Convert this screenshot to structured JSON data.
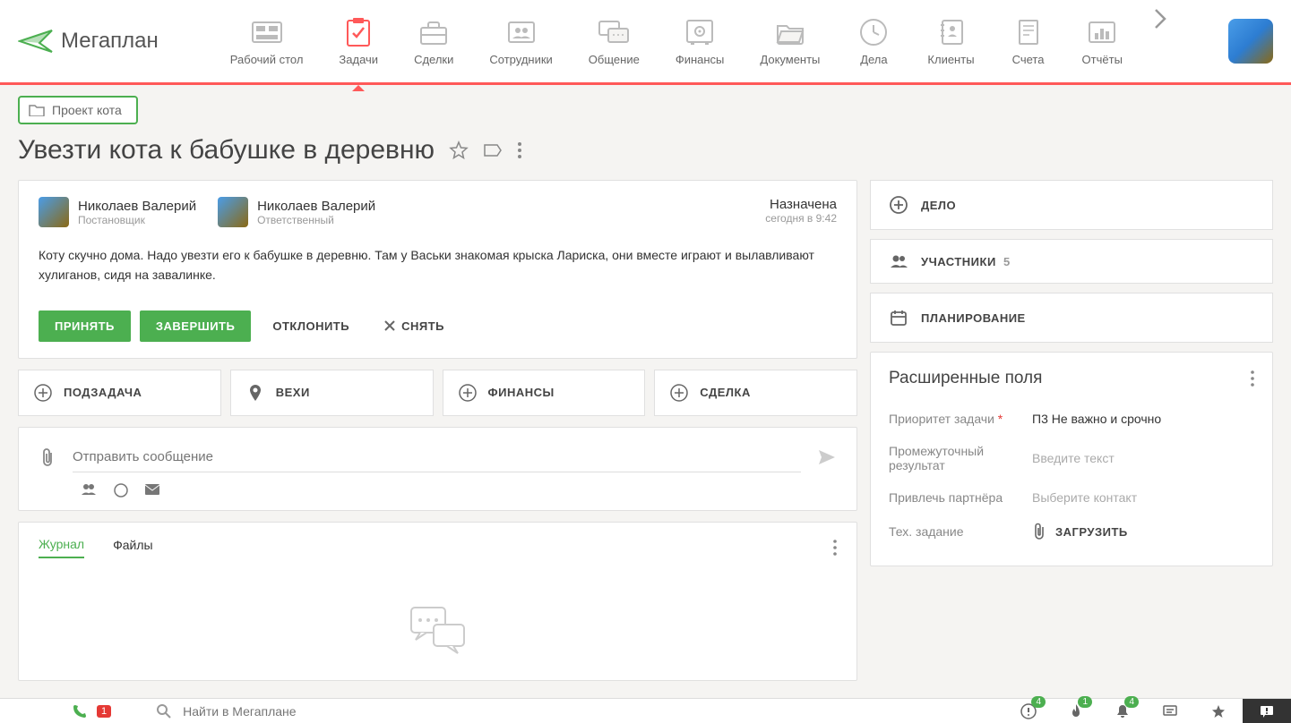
{
  "logo": {
    "text": "Мегаплан"
  },
  "nav": {
    "items": [
      {
        "label": "Рабочий стол"
      },
      {
        "label": "Задачи"
      },
      {
        "label": "Сделки"
      },
      {
        "label": "Сотрудники"
      },
      {
        "label": "Общение"
      },
      {
        "label": "Финансы"
      },
      {
        "label": "Документы"
      },
      {
        "label": "Дела"
      },
      {
        "label": "Клиенты"
      },
      {
        "label": "Счета"
      },
      {
        "label": "Отчёты"
      }
    ]
  },
  "breadcrumb": {
    "label": "Проект кота"
  },
  "task": {
    "title": "Увезти кота к бабушке в деревню",
    "assignee1": {
      "name": "Николаев Валерий",
      "role": "Постановщик"
    },
    "assignee2": {
      "name": "Николаев Валерий",
      "role": "Ответственный"
    },
    "status": {
      "label": "Назначена",
      "time": "сегодня в 9:42"
    },
    "description": "Коту скучно дома. Надо увезти его к бабушке в деревню. Там у Васьки знакомая крыска Лариска, они вместе играют и вылавливают хулиганов, сидя на завалинке.",
    "actions": {
      "accept": "ПРИНЯТЬ",
      "complete": "ЗАВЕРШИТЬ",
      "reject": "ОТКЛОНИТЬ",
      "remove": "СНЯТЬ"
    }
  },
  "add_cards": {
    "subtask": "ПОДЗАДАЧА",
    "milestones": "ВЕХИ",
    "finances": "ФИНАНСЫ",
    "deal": "СДЕЛКА"
  },
  "message": {
    "placeholder": "Отправить сообщение"
  },
  "tabs": {
    "journal": "Журнал",
    "files": "Файлы"
  },
  "sidebar": {
    "case": "ДЕЛО",
    "participants": "УЧАСТНИКИ",
    "participants_count": "5",
    "planning": "ПЛАНИРОВАНИЕ"
  },
  "extended": {
    "title": "Расширенные поля",
    "priority_label": "Приоритет задачи",
    "priority_value": "П3 Не важно и срочно",
    "interim_label": "Промежуточный результат",
    "interim_placeholder": "Введите текст",
    "partner_label": "Привлечь партнёра",
    "partner_placeholder": "Выберите контакт",
    "tech_label": "Тех. задание",
    "upload": "ЗАГРУЗИТЬ"
  },
  "footer": {
    "phone_badge": "1",
    "search_placeholder": "Найти в Мегаплане",
    "badges": {
      "alert": "4",
      "fire": "1",
      "bell": "4"
    }
  }
}
